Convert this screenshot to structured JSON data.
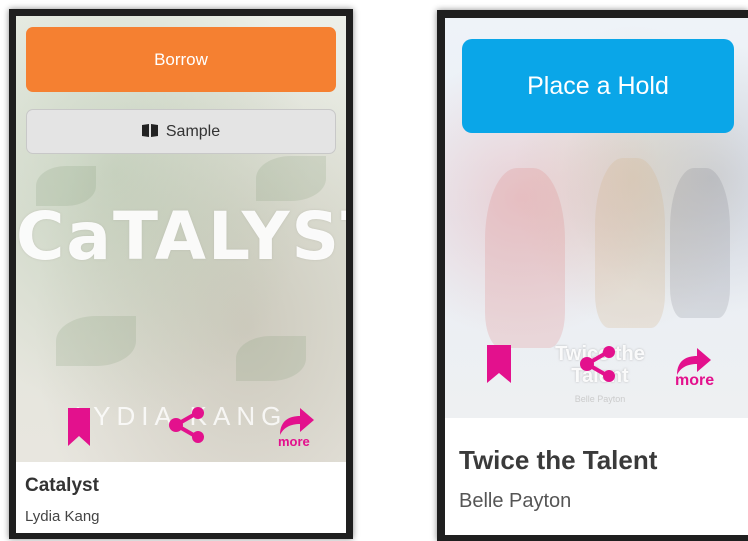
{
  "colors": {
    "borrow": "#f58031",
    "hold": "#0aa6e8",
    "accent_pink": "#e3118d"
  },
  "left_card": {
    "borrow_label": "Borrow",
    "sample_label": "Sample",
    "sample_icon": "book-icon",
    "cover_art_title": "CaTALYST",
    "cover_art_author": "LYDIA KANG",
    "actions": {
      "bookmark_icon": "bookmark-icon",
      "share_icon": "share-icon",
      "more_icon": "share-arrow-icon",
      "more_label": "more"
    },
    "title": "Catalyst",
    "author": "Lydia Kang"
  },
  "right_card": {
    "hold_label": "Place a Hold",
    "cover_art_title": "Twice the Talent",
    "cover_art_subtitle": "Belle Payton",
    "actions": {
      "bookmark_icon": "bookmark-icon",
      "share_icon": "share-icon",
      "more_icon": "share-arrow-icon",
      "more_label": "more"
    },
    "title": "Twice the Talent",
    "author": "Belle Payton"
  }
}
